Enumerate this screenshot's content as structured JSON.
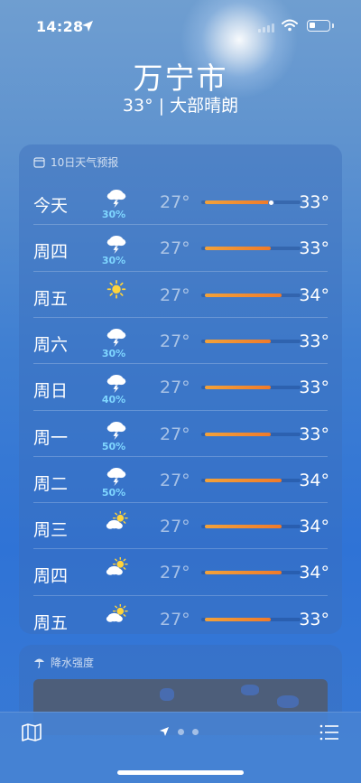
{
  "status_bar": {
    "time": "14:28"
  },
  "header": {
    "city": "万宁市",
    "summary": "33° | 大部晴朗"
  },
  "forecast": {
    "title": "10日天气预报",
    "scale_min": 27,
    "scale_max": 34,
    "current_temp": 33,
    "days": [
      {
        "day": "今天",
        "icon": "thunderstorm-icon",
        "pop": "30%",
        "low": "27°",
        "high": "33°",
        "lo": 27,
        "hi": 33,
        "now": true
      },
      {
        "day": "周四",
        "icon": "thunderstorm-icon",
        "pop": "30%",
        "low": "27°",
        "high": "33°",
        "lo": 27,
        "hi": 33
      },
      {
        "day": "周五",
        "icon": "sun-icon",
        "pop": "",
        "low": "27°",
        "high": "34°",
        "lo": 27,
        "hi": 34
      },
      {
        "day": "周六",
        "icon": "thunderstorm-icon",
        "pop": "30%",
        "low": "27°",
        "high": "33°",
        "lo": 27,
        "hi": 33
      },
      {
        "day": "周日",
        "icon": "thunderstorm-icon",
        "pop": "40%",
        "low": "27°",
        "high": "33°",
        "lo": 27,
        "hi": 33
      },
      {
        "day": "周一",
        "icon": "thunderstorm-icon",
        "pop": "50%",
        "low": "27°",
        "high": "33°",
        "lo": 27,
        "hi": 33
      },
      {
        "day": "周二",
        "icon": "thunderstorm-icon",
        "pop": "50%",
        "low": "27°",
        "high": "34°",
        "lo": 27,
        "hi": 34
      },
      {
        "day": "周三",
        "icon": "partly-cloudy-icon",
        "pop": "",
        "low": "27°",
        "high": "34°",
        "lo": 27,
        "hi": 34
      },
      {
        "day": "周四",
        "icon": "partly-cloudy-icon",
        "pop": "",
        "low": "27°",
        "high": "34°",
        "lo": 27,
        "hi": 34
      },
      {
        "day": "周五",
        "icon": "partly-cloudy-icon",
        "pop": "",
        "low": "27°",
        "high": "33°",
        "lo": 27,
        "hi": 33
      }
    ]
  },
  "precipitation": {
    "title": "降水强度"
  },
  "colors": {
    "bar_start": "#f2a23a",
    "bar_end": "#ef7a2a",
    "pop_text": "#7fd6ff"
  }
}
